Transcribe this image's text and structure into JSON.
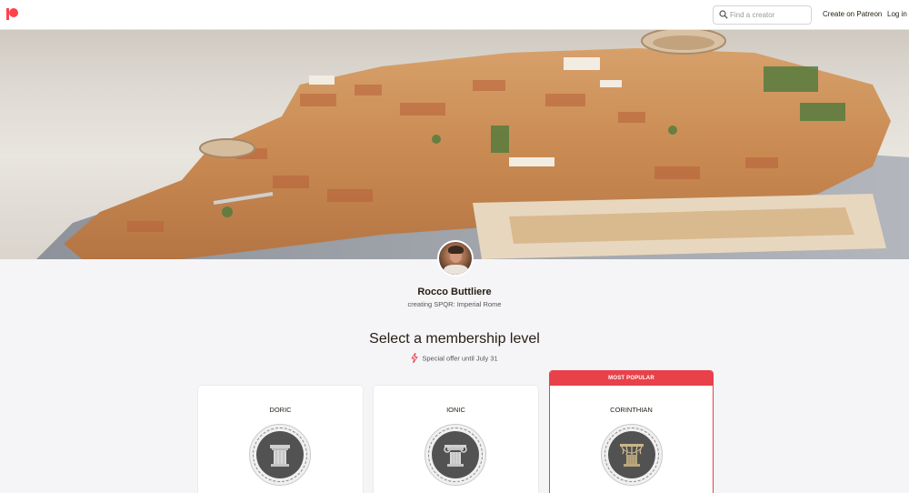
{
  "header": {
    "logo_icon": "patreon-logo",
    "search_placeholder": "Find a creator",
    "create_label": "Create on Patreon",
    "login_label": "Log in",
    "accent_color": "#ff424d"
  },
  "creator": {
    "name": "Rocco Buttliere",
    "tagline": "creating SPQR: Imperial Rome"
  },
  "membership": {
    "title": "Select a membership level",
    "offer_text": "Special offer until July 31",
    "offer_icon": "lightning-bolt-icon"
  },
  "tiers": [
    {
      "name": "DORIC",
      "emblem_icon": "doric-column-icon",
      "popular": false
    },
    {
      "name": "IONIC",
      "emblem_icon": "ionic-column-icon",
      "popular": false
    },
    {
      "name": "CORINTHIAN",
      "emblem_icon": "corinthian-column-icon",
      "popular": true,
      "badge": "MOST POPULAR",
      "badge_color": "#e8414a"
    }
  ]
}
